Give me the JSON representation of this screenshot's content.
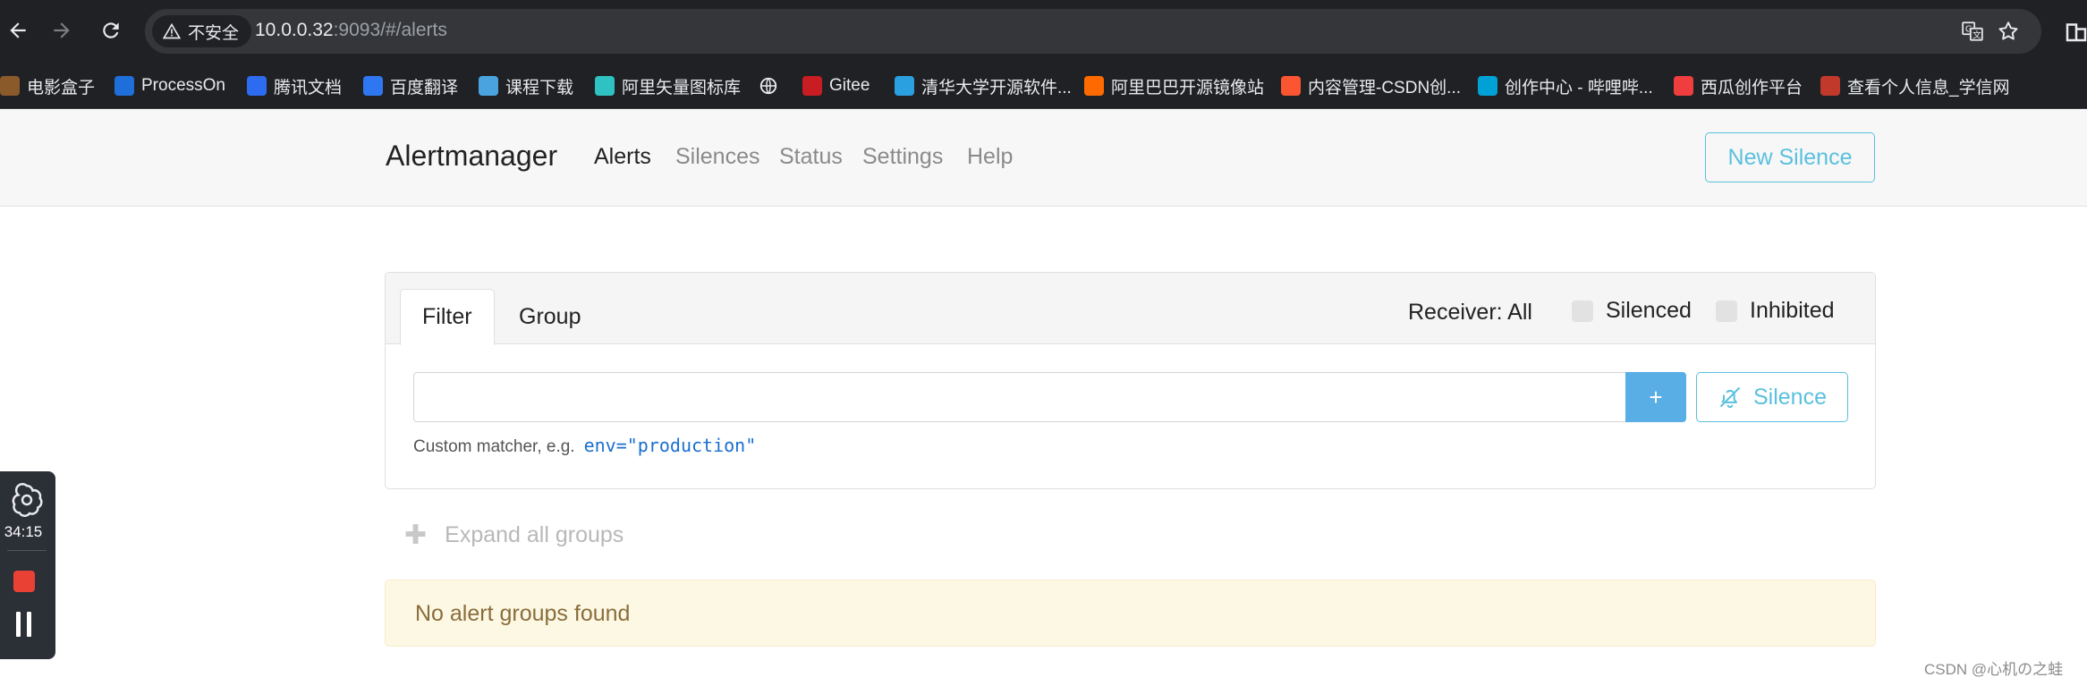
{
  "browser": {
    "security_label": "不安全",
    "url_host": "10.0.0.32",
    "url_rest": ":9093/#/alerts",
    "bookmarks": [
      {
        "label": "电影盒子",
        "icon": "film-icon",
        "color": "#8b5a2b"
      },
      {
        "label": "ProcessOn",
        "icon": "processon-icon",
        "color": "#1e6fd9"
      },
      {
        "label": "腾讯文档",
        "icon": "tencent-docs-icon",
        "color": "#2d6bf0"
      },
      {
        "label": "百度翻译",
        "icon": "baidu-translate-icon",
        "color": "#2f77f1"
      },
      {
        "label": "课程下载",
        "icon": "course-download-icon",
        "color": "#4aa3df"
      },
      {
        "label": "阿里矢量图标库",
        "icon": "iconfont-icon",
        "color": "#2ec2c2"
      },
      {
        "label": "",
        "icon": "globe-icon",
        "color": "#e8eaed"
      },
      {
        "label": "Gitee",
        "icon": "gitee-icon",
        "color": "#c71d23"
      },
      {
        "label": "清华大学开源软件...",
        "icon": "tuna-icon",
        "color": "#2aa0e0"
      },
      {
        "label": "阿里巴巴开源镜像站",
        "icon": "aliyun-icon",
        "color": "#ff6a00"
      },
      {
        "label": "内容管理-CSDN创...",
        "icon": "csdn-icon",
        "color": "#fc5531"
      },
      {
        "label": "创作中心 - 哔哩哔...",
        "icon": "bilibili-icon",
        "color": "#00a1d6"
      },
      {
        "label": "西瓜创作平台",
        "icon": "xigua-icon",
        "color": "#f03d3d"
      },
      {
        "label": "查看个人信息_学信网",
        "icon": "chsi-icon",
        "color": "#c0392b"
      }
    ]
  },
  "navbar": {
    "brand": "Alertmanager",
    "links": [
      "Alerts",
      "Silences",
      "Status",
      "Settings",
      "Help"
    ],
    "new_silence": "New Silence"
  },
  "filter_card": {
    "tabs": [
      "Filter",
      "Group"
    ],
    "receiver": "Receiver: All",
    "silenced": "Silenced",
    "inhibited": "Inhibited",
    "matcher_value": "",
    "add_button": "+",
    "silence_button": "Silence",
    "hint_text": "Custom matcher, e.g.",
    "hint_example": "env=\"production\""
  },
  "expand_groups": "Expand all groups",
  "empty_message": "No alert groups found",
  "recorder": {
    "time": "34:15"
  },
  "watermark": "CSDN @心机の之蛙"
}
